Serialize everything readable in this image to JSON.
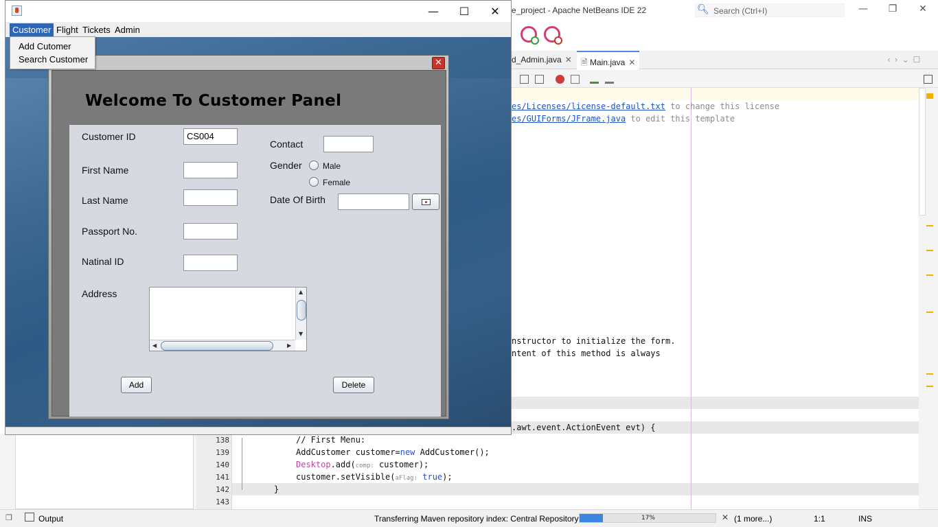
{
  "ide": {
    "title": "e_project - Apache NetBeans IDE 22",
    "search_placeholder": "Search (Ctrl+I)",
    "tabs": [
      {
        "label": "d_Admin.java",
        "active": false
      },
      {
        "label": "Main.java",
        "active": true
      }
    ],
    "code_lines": [
      {
        "pre": "",
        "link": "es/Licenses/license-default.txt",
        "post": " to change this license"
      },
      {
        "pre": "",
        "link": "es/GUIForms/JFrame.java",
        "post": " to edit this template"
      }
    ],
    "comment_lines": [
      "nstructor to initialize the form.",
      "ntent of this method is always"
    ],
    "method_line": ".awt.event.ActionEvent evt) {",
    "line_numbers": [
      "138",
      "139",
      "140",
      "141",
      "142",
      "143"
    ],
    "code": {
      "l138": "// First Menu:",
      "l139_a": "AddCustomer customer=",
      "l139_kw": "new",
      "l139_b": " AddCustomer();",
      "l140_obj": "Desktop",
      "l140_a": ".add(",
      "l140_hint": "comp:",
      "l140_b": " customer);",
      "l141_a": "customer.setVisible(",
      "l141_hint": "aFlag:",
      "l141_kw": "true",
      "l141_b": ");",
      "l142": "}"
    },
    "status": {
      "output_label": "Output",
      "task": "Transferring Maven repository index: Central Repository",
      "progress_percent": 17,
      "progress_text": "17%",
      "more": "(1 more...)",
      "position": "1:1",
      "mode": "INS"
    }
  },
  "app": {
    "menus": [
      "Customer",
      "Flight",
      "Tickets",
      "Admin"
    ],
    "dropdown_items": [
      "Add Cutomer",
      "Search Customer"
    ],
    "panel_title": "Welcome To Customer Panel",
    "form": {
      "customer_id_label": "Customer ID",
      "customer_id_value": "CS004",
      "first_name_label": "First Name",
      "last_name_label": "Last Name",
      "passport_label": "Passport No.",
      "national_id_label": "Natinal ID",
      "address_label": "Address",
      "contact_label": "Contact",
      "gender_label": "Gender",
      "gender_male": "Male",
      "gender_female": "Female",
      "dob_label": "Date Of Birth",
      "add_button": "Add",
      "delete_button": "Delete"
    }
  }
}
